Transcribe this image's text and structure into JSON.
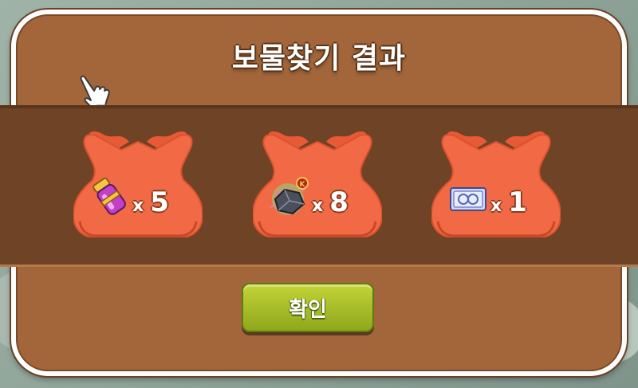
{
  "dialog": {
    "title": "보물찾기 결과",
    "confirm_label": "확인"
  },
  "rewards": [
    {
      "icon": "potion-icon",
      "x_label": "x",
      "quantity": "5"
    },
    {
      "icon": "gem-ore-icon",
      "x_label": "x",
      "quantity": "8"
    },
    {
      "icon": "ticket-icon",
      "x_label": "x",
      "quantity": "1"
    }
  ],
  "colors": {
    "panel": "#a3663a",
    "strip": "#6e4326",
    "bag": "#f26a45",
    "button": "#a9bf28"
  }
}
